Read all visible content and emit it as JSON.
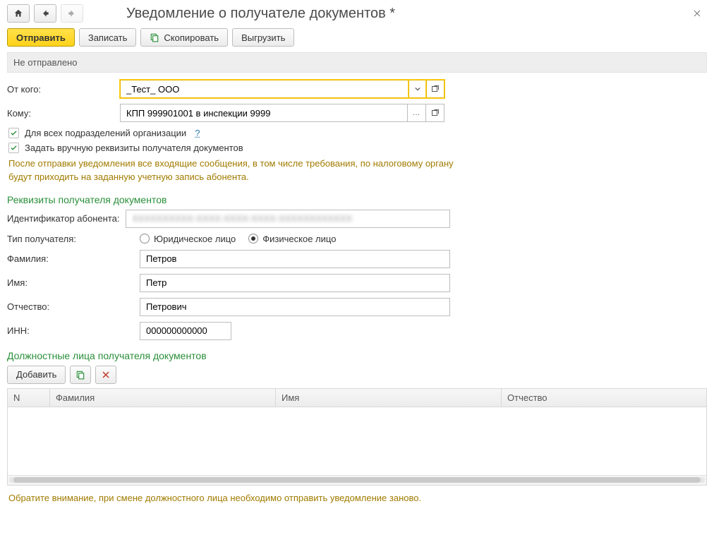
{
  "header": {
    "title": "Уведомление о получателе документов *"
  },
  "commands": {
    "send": "Отправить",
    "save": "Записать",
    "copy": "Скопировать",
    "export": "Выгрузить"
  },
  "status": "Не отправлено",
  "from": {
    "label": "От кого:",
    "value": "_Тест_ ООО"
  },
  "to": {
    "label": "Кому:",
    "value": "КПП 999901001 в инспекции 9999"
  },
  "checks": {
    "all_units": "Для всех подразделений организации",
    "manual": "Задать вручную реквизиты получателя документов"
  },
  "info": "После отправки уведомления все входящие сообщения, в том числе требования, по налоговому органу будут приходить на заданную учетную запись абонента.",
  "section_recipient": "Реквизиты получателя документов",
  "fields": {
    "subscriber_id_label": "Идентификатор абонента:",
    "subscriber_id_value": "XXXXXXXXXX-XXXX-XXXX-XXXX-XXXXXXXXXXXX",
    "type_label": "Тип получателя:",
    "type_legal": "Юридическое лицо",
    "type_person": "Физическое лицо",
    "lastname_label": "Фамилия:",
    "lastname_value": "Петров",
    "firstname_label": "Имя:",
    "firstname_value": "Петр",
    "patronymic_label": "Отчество:",
    "patronymic_value": "Петрович",
    "inn_label": "ИНН:",
    "inn_value": "000000000000"
  },
  "section_officials": "Должностные лица получателя документов",
  "officials_toolbar": {
    "add": "Добавить"
  },
  "table": {
    "cols": {
      "n": "N",
      "lastname": "Фамилия",
      "firstname": "Имя",
      "patronymic": "Отчество"
    }
  },
  "footer": "Обратите внимание, при смене должностного лица необходимо отправить уведомление заново."
}
